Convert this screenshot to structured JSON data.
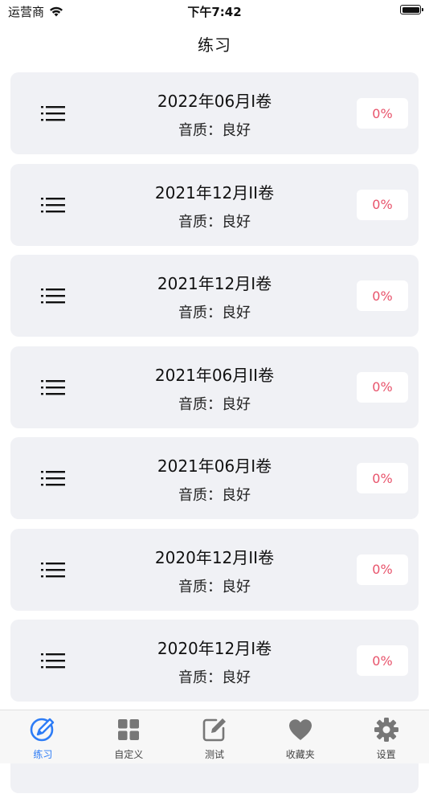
{
  "status_bar": {
    "carrier": "运营商",
    "time": "下午7:42"
  },
  "nav": {
    "title": "练习"
  },
  "papers": [
    {
      "title": "2022年06月I卷",
      "quality": "音质：良好",
      "progress": "0%"
    },
    {
      "title": "2021年12月II卷",
      "quality": "音质：良好",
      "progress": "0%"
    },
    {
      "title": "2021年12月I卷",
      "quality": "音质：良好",
      "progress": "0%"
    },
    {
      "title": "2021年06月II卷",
      "quality": "音质：良好",
      "progress": "0%"
    },
    {
      "title": "2021年06月I卷",
      "quality": "音质：良好",
      "progress": "0%"
    },
    {
      "title": "2020年12月II卷",
      "quality": "音质：良好",
      "progress": "0%"
    },
    {
      "title": "2020年12月I卷",
      "quality": "音质：良好",
      "progress": "0%"
    }
  ],
  "tabs": [
    {
      "label": "练习",
      "icon": "pen-circle-icon",
      "active": true
    },
    {
      "label": "自定义",
      "icon": "grid-icon",
      "active": false
    },
    {
      "label": "测试",
      "icon": "edit-icon",
      "active": false
    },
    {
      "label": "收藏夹",
      "icon": "heart-icon",
      "active": false
    },
    {
      "label": "设置",
      "icon": "gear-icon",
      "active": false
    }
  ],
  "colors": {
    "accent": "#2d7cf6",
    "progress_text": "#e8536b",
    "card_bg": "#f0f1f5"
  }
}
